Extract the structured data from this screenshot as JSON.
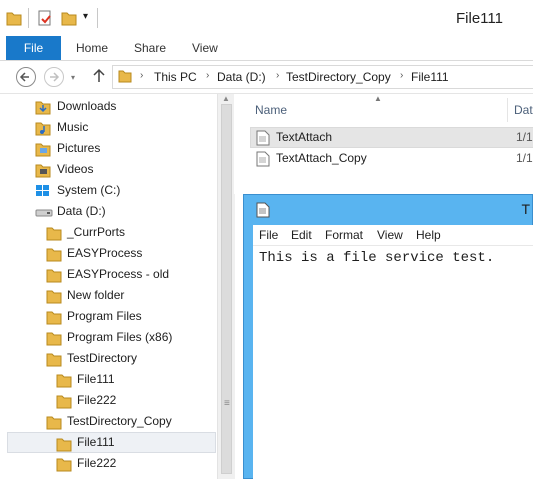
{
  "window": {
    "title": "File111"
  },
  "qat": {
    "dropdown_glyph": "▾"
  },
  "ribbon": {
    "tabs": [
      {
        "label": "File"
      },
      {
        "label": "Home"
      },
      {
        "label": "Share"
      },
      {
        "label": "View"
      }
    ]
  },
  "address": {
    "breadcrumbs": [
      "This PC",
      "Data (D:)",
      "TestDirectory_Copy",
      "File111"
    ],
    "separator": "›"
  },
  "nav_pane": {
    "items": [
      {
        "label": "Downloads",
        "icon": "downloads-icon"
      },
      {
        "label": "Music",
        "icon": "music-icon"
      },
      {
        "label": "Pictures",
        "icon": "pictures-icon"
      },
      {
        "label": "Videos",
        "icon": "videos-icon"
      },
      {
        "label": "System (C:)",
        "icon": "system-drive-icon"
      },
      {
        "label": "Data (D:)",
        "icon": "drive-icon"
      },
      {
        "label": "_CurrPorts",
        "icon": "folder-icon"
      },
      {
        "label": "EASYProcess",
        "icon": "folder-icon"
      },
      {
        "label": "EASYProcess - old",
        "icon": "folder-icon"
      },
      {
        "label": "New folder",
        "icon": "folder-icon"
      },
      {
        "label": "Program Files",
        "icon": "folder-icon"
      },
      {
        "label": "Program Files (x86)",
        "icon": "folder-icon"
      },
      {
        "label": "TestDirectory",
        "icon": "folder-icon"
      },
      {
        "label": "File111",
        "icon": "folder-icon"
      },
      {
        "label": "File222",
        "icon": "folder-icon"
      },
      {
        "label": "TestDirectory_Copy",
        "icon": "folder-icon"
      },
      {
        "label": "File111",
        "icon": "folder-icon",
        "selected": true
      },
      {
        "label": "File222",
        "icon": "folder-icon"
      }
    ]
  },
  "file_list": {
    "columns": {
      "name": "Name",
      "date": "Dat"
    },
    "rows": [
      {
        "name": "TextAttach",
        "date": "1/1",
        "selected": true
      },
      {
        "name": "TextAttach_Copy",
        "date": "1/1"
      }
    ]
  },
  "notepad": {
    "title": "T",
    "menu": [
      "File",
      "Edit",
      "Format",
      "View",
      "Help"
    ],
    "content": "This is a file service test."
  },
  "colors": {
    "accent": "#1979ca",
    "notepad_frame": "#59b4f0",
    "folder": "#e8b84a"
  }
}
